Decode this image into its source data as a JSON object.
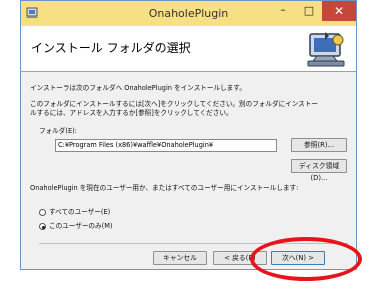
{
  "window": {
    "title": "OnaholePlugin",
    "min_glyph": "–",
    "max_glyph": "□",
    "close_glyph": "✕"
  },
  "header": {
    "title": "インストール フォルダの選択"
  },
  "body": {
    "intro": "インストーラは次のフォルダへ OnaholePlugin をインストールします。",
    "instructions_line1": "このフォルダにインストールするには[次へ]をクリックしてください。別のフォルダにインストー",
    "instructions_line2": "ルするには、アドレスを入力するか[参照]をクリックしてください。",
    "folder_label": "フォルダ(E):",
    "folder_value": "C:¥Program Files (x86)¥waffle¥OnaholePlugin¥",
    "browse_label": "参照(R)...",
    "disk_cost_label": "ディスク領域(D)...",
    "install_for_question": "OnaholePlugin を現在のユーザー用か、またはすべてのユーザー用にインストールします:",
    "radio_all_users": "すべてのユーザー(E)",
    "radio_this_user": "このユーザーのみ(M)",
    "selected_option": "このユーザーのみ(M)"
  },
  "footer": {
    "cancel_label": "キャンセル",
    "back_label": "< 戻る(B)",
    "next_label": "次へ(N) >"
  },
  "colors": {
    "titlebar": "#f7e084",
    "close_button": "#c7463b",
    "annotation_oval": "#e8141c"
  },
  "icons": {
    "app_icon": "installer-app-icon",
    "header_icon": "computer-setup-icon"
  }
}
